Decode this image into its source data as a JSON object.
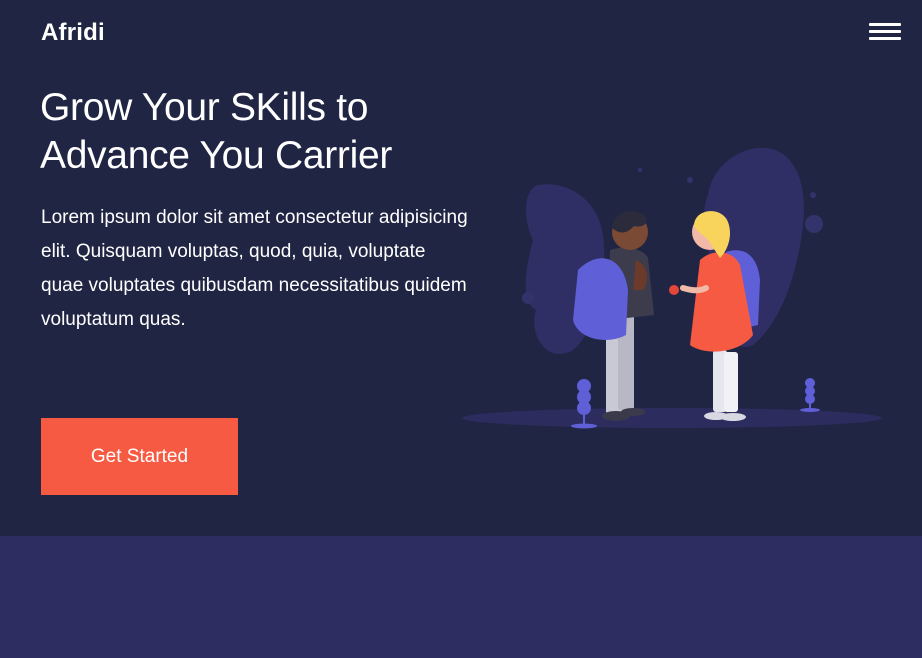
{
  "brand": {
    "logo_text": "Afridi"
  },
  "nav": {
    "menu_icon": "hamburger-menu-icon"
  },
  "hero": {
    "title_line1": "Grow Your SKills to",
    "title_line2": "Advance You Carrier",
    "description": "Lorem ipsum dolor sit amet consectetur adipisicing elit. Quisquam voluptas, quod, quia, voluptate quae voluptates quibusdam necessitatibus quidem voluptatum quas.",
    "cta_label": "Get Started",
    "illustration_icon": "students-with-backpacks-illustration"
  },
  "colors": {
    "hero_bg": "#202544",
    "lower_bg": "#2d2d62",
    "accent": "#f75a42",
    "illustration_purple": "#5f5fd8",
    "illustration_blob": "#2f2f66"
  }
}
